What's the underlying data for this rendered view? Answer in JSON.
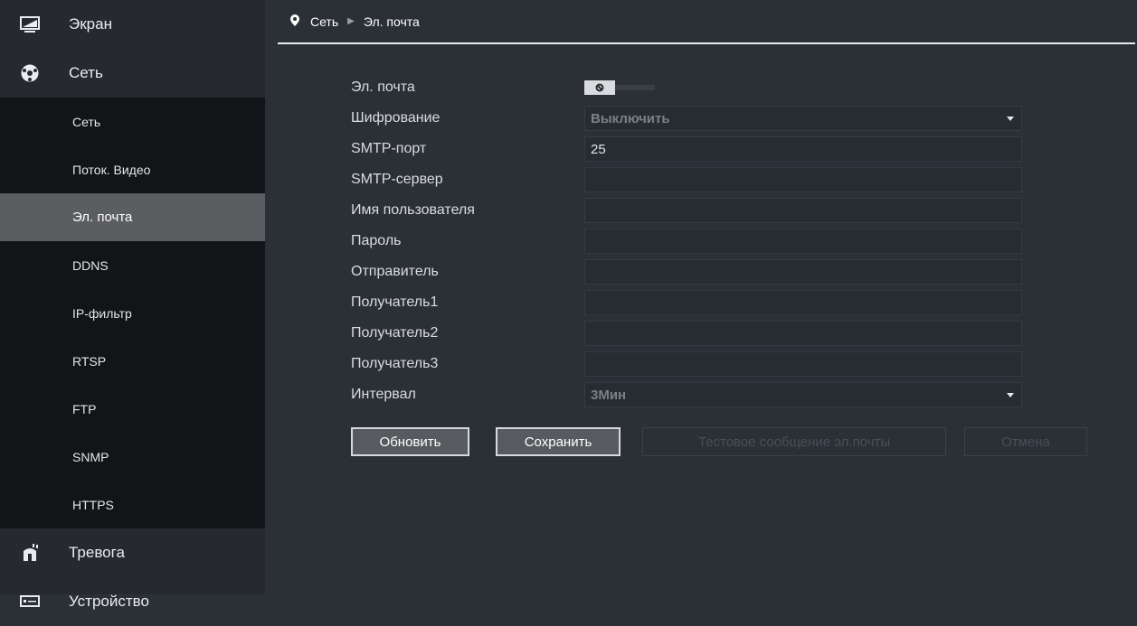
{
  "sidebar": {
    "main_items": [
      {
        "label": "Экран",
        "icon": "monitor-icon"
      },
      {
        "label": "Сеть",
        "icon": "network-icon"
      },
      {
        "label": "Тревога",
        "icon": "alarm-icon"
      },
      {
        "label": "Устройство",
        "icon": "device-icon"
      }
    ],
    "sub_items": [
      {
        "label": "Сеть"
      },
      {
        "label": "Поток. Видео"
      },
      {
        "label": "Эл. почта"
      },
      {
        "label": "DDNS"
      },
      {
        "label": "IP-фильтр"
      },
      {
        "label": "RTSP"
      },
      {
        "label": "FTP"
      },
      {
        "label": "SNMP"
      },
      {
        "label": "HTTPS"
      }
    ],
    "active_sub_item": "Эл. почта"
  },
  "breadcrumb": {
    "section": "Сеть",
    "page": "Эл. почта"
  },
  "form": {
    "email_label": "Эл. почта",
    "email_toggle_state": "off",
    "encryption_label": "Шифрование",
    "encryption_value": "Выключить",
    "smtp_port_label": "SMTP-порт",
    "smtp_port_value": "25",
    "smtp_server_label": "SMTP-сервер",
    "smtp_server_value": "",
    "username_label": "Имя пользователя",
    "username_value": "",
    "password_label": "Пароль",
    "password_value": "",
    "sender_label": "Отправитель",
    "sender_value": "",
    "recipient1_label": "Получатель1",
    "recipient1_value": "",
    "recipient2_label": "Получатель2",
    "recipient2_value": "",
    "recipient3_label": "Получатель3",
    "recipient3_value": "",
    "interval_label": "Интервал",
    "interval_value": "3Мин"
  },
  "buttons": {
    "refresh": "Обновить",
    "save": "Сохранить",
    "test_email": "Тестовое сообщение эл.почты",
    "cancel": "Отмена"
  },
  "colors": {
    "sidebar_bg": "#262a30",
    "submenu_bg": "#121417",
    "active_item_bg": "#5b5d60",
    "content_bg": "#2b2f36"
  }
}
